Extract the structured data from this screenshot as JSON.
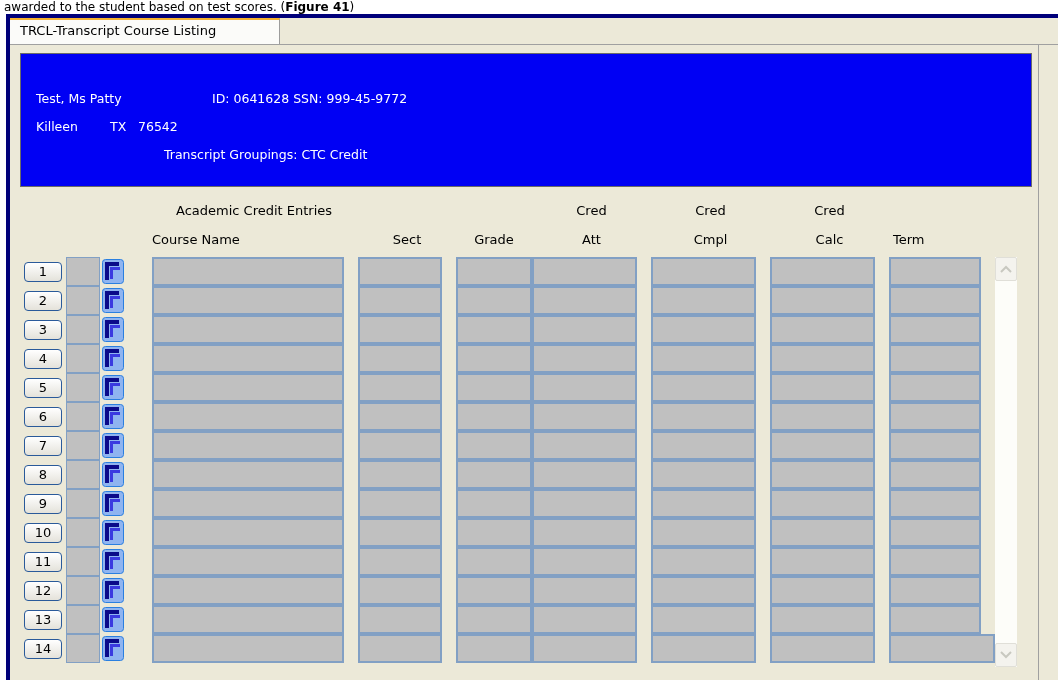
{
  "document_caption": "awarded to the student based on test scores. (**Figure 41**)",
  "tabs": [
    {
      "label": "TRCL-Transcript Course Listing",
      "selected": true
    }
  ],
  "student": {
    "name": "Test, Ms Patty",
    "id_ssn": "ID: 0641628 SSN: 999-45-9772",
    "city": "Killeen",
    "state": "TX",
    "zip": "76542",
    "groupings": "Transcript Groupings:  CTC Credit"
  },
  "table": {
    "title": "Academic Credit Entries",
    "columns": [
      {
        "line_2": "Course Name"
      },
      {
        "line_2": "Sect"
      },
      {
        "line_2": "Grade"
      },
      {
        "line_1": "Cred",
        "line_2": "Att"
      },
      {
        "line_1": "Cred",
        "line_2": "Cmpl"
      },
      {
        "line_1": "Cred",
        "line_2": "Calc"
      },
      {
        "line_2": "Term"
      }
    ],
    "rows": [
      {
        "number": "1"
      },
      {
        "number": "2"
      },
      {
        "number": "3"
      },
      {
        "number": "4"
      },
      {
        "number": "5"
      },
      {
        "number": "6"
      },
      {
        "number": "7"
      },
      {
        "number": "8"
      },
      {
        "number": "9"
      },
      {
        "number": "10"
      },
      {
        "number": "11"
      },
      {
        "number": "12"
      },
      {
        "number": "13"
      },
      {
        "number": "14"
      }
    ]
  }
}
